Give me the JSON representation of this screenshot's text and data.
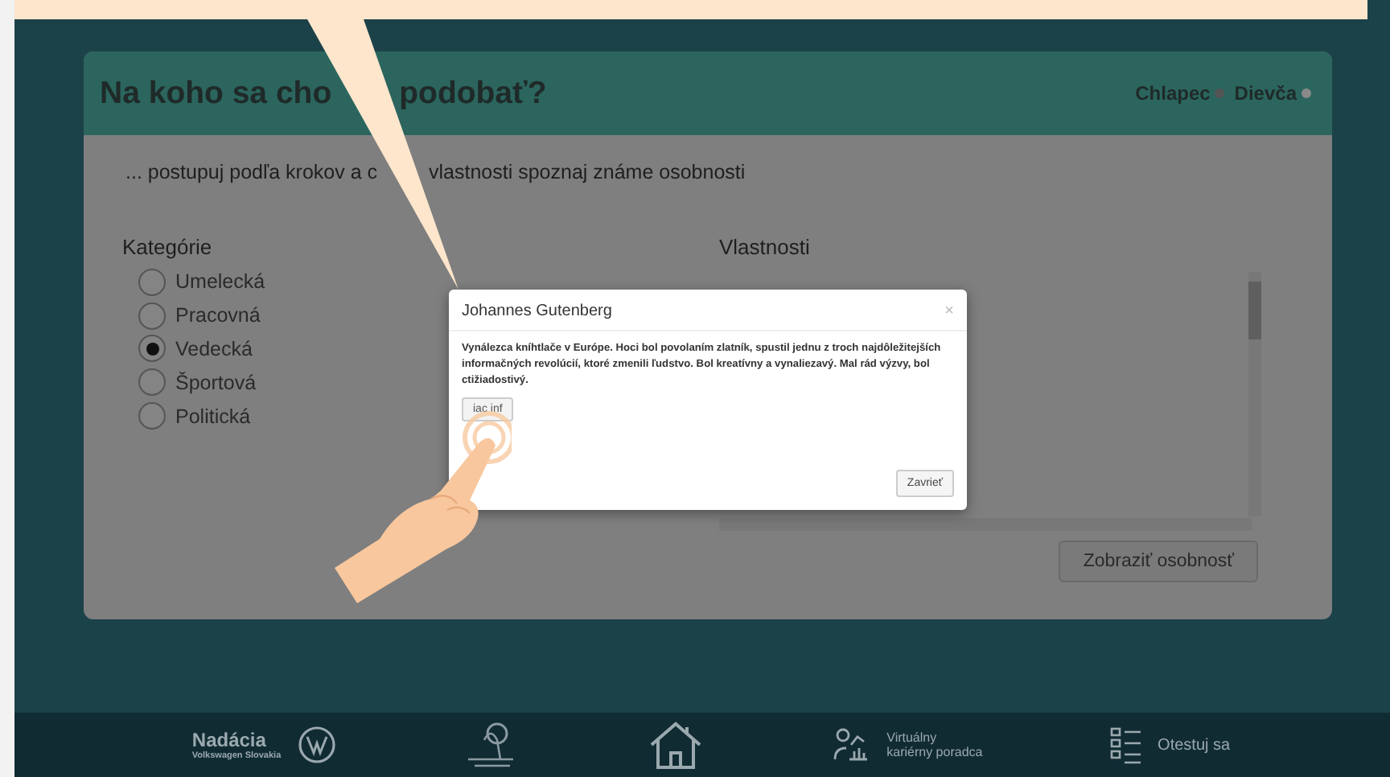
{
  "card": {
    "title_parts": [
      "Na koho sa cho",
      "podobať?"
    ],
    "gender_options": [
      "Chlapec",
      "Dievča"
    ],
    "subtitle_parts": [
      "... postupuj podľa krokov a c",
      "vlastnosti spoznaj známe osobnosti"
    ],
    "categories": {
      "heading": "Kategórie",
      "options": [
        {
          "label": "Umelecká",
          "selected": false
        },
        {
          "label": "Pracovná",
          "selected": false
        },
        {
          "label": "Vedecká",
          "selected": true
        },
        {
          "label": "Športová",
          "selected": false
        },
        {
          "label": "Politická",
          "selected": false
        }
      ]
    },
    "properties": {
      "heading": "Vlastnosti"
    },
    "show_button": "Zobraziť osobnosť"
  },
  "modal": {
    "title": "Johannes Gutenberg",
    "close": "×",
    "body": "Vynálezca kníhtlače v Európe. Hoci bol povolaním zlatník, spustil jednu z troch najdôležitejších informačných revolúcií, ktoré zmenili ľudstvo. Bol kreatívny a vynaliezavý. Mal rád výzvy, bol ctižiadostivý.",
    "more_button": "iac inf",
    "close_button": "Zavrieť"
  },
  "footer": {
    "foundation": {
      "name": "Nadácia",
      "sub": "Volkswagen Slovakia"
    },
    "advisor": [
      "Virtuálny",
      "kariérny poradca"
    ],
    "test": "Otestuj sa"
  }
}
